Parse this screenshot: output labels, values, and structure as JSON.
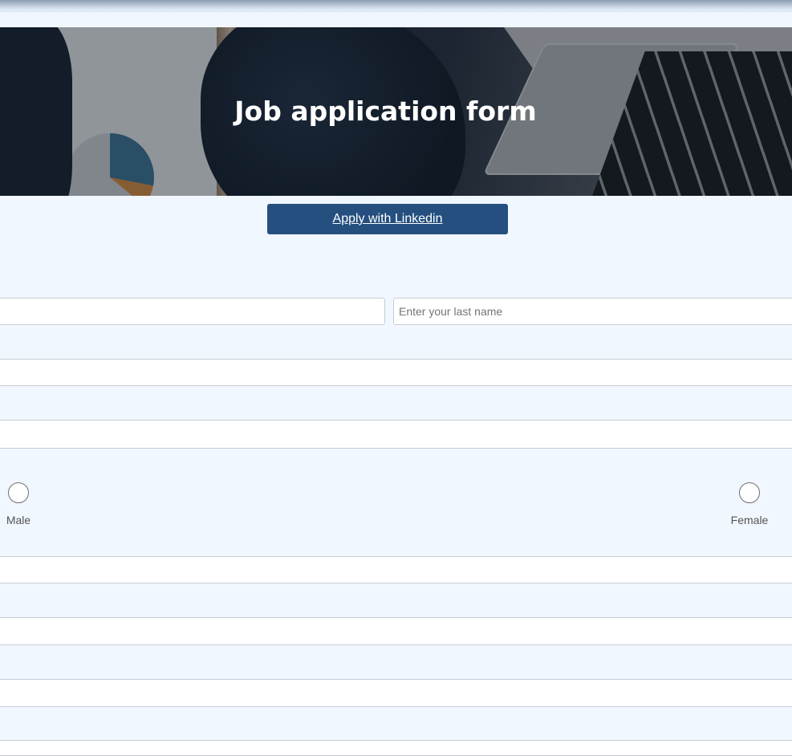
{
  "header": {
    "title": "Job application form"
  },
  "linkedin": {
    "label": "Apply with Linkedin"
  },
  "form": {
    "first_name": {
      "value": "",
      "placeholder": ""
    },
    "last_name": {
      "value": "",
      "placeholder": "Enter your last name"
    },
    "gender_options": [
      "Male",
      "Female"
    ]
  },
  "colors": {
    "background": "#f1f7ff",
    "button": "#244f7f",
    "button_text": "#ffffff"
  }
}
